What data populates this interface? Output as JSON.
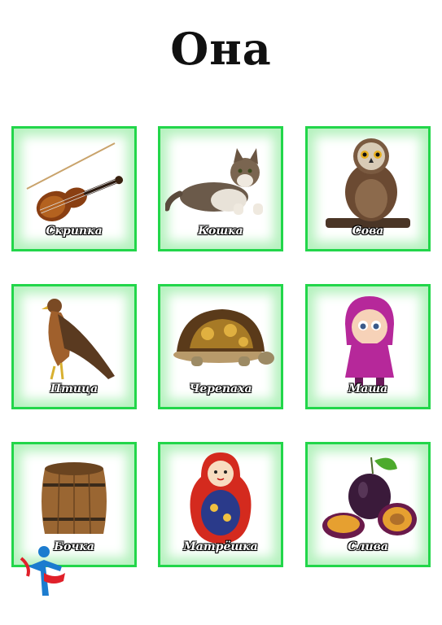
{
  "title": "Она",
  "cards": [
    {
      "label": "Скрипка",
      "icon": "violin-icon"
    },
    {
      "label": "Кошка",
      "icon": "cat-icon"
    },
    {
      "label": "Сова",
      "icon": "owl-icon"
    },
    {
      "label": "Птица",
      "icon": "bird-icon"
    },
    {
      "label": "Черепаха",
      "icon": "turtle-icon"
    },
    {
      "label": "Маша",
      "icon": "masha-doll-icon"
    },
    {
      "label": "Бочка",
      "icon": "barrel-icon"
    },
    {
      "label": "Матрёшка",
      "icon": "matryoshka-icon"
    },
    {
      "label": "Слива",
      "icon": "plum-icon"
    }
  ],
  "colors": {
    "frame": "#22d64a",
    "glow": "#b6f2bf"
  }
}
